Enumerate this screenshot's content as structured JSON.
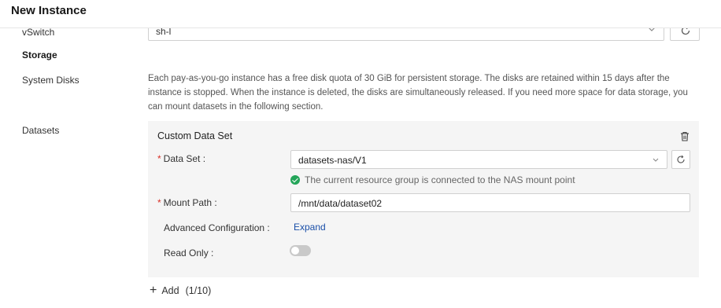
{
  "header": {
    "title": "New Instance"
  },
  "vswitch": {
    "label": "vSwitch",
    "value": "sh-l"
  },
  "storage": {
    "section_title": "Storage",
    "system_disks_label": "System Disks",
    "description": "Each pay-as-you-go instance has a free disk quota of 30 GiB for persistent storage. The disks are retained within 15 days after the instance is stopped. When the instance is deleted, the disks are simultaneously released. If you need more space for data storage, you can mount datasets in the following section.",
    "datasets_label": "Datasets"
  },
  "dataset_card": {
    "title": "Custom Data Set",
    "data_set_label": "Data Set :",
    "data_set_value": "datasets-nas/V1",
    "status_text": "The current resource group is connected to the NAS mount point",
    "mount_path_label": "Mount Path :",
    "mount_path_value": "/mnt/data/dataset02",
    "advanced_label": "Advanced Configuration :",
    "expand_link": "Expand",
    "read_only_label": "Read Only :",
    "read_only": false,
    "required_mark": "*"
  },
  "add": {
    "label": "Add",
    "count": "(1/10)"
  },
  "colors": {
    "link": "#1a4fa8",
    "required": "#d93026",
    "success": "#23a559"
  }
}
